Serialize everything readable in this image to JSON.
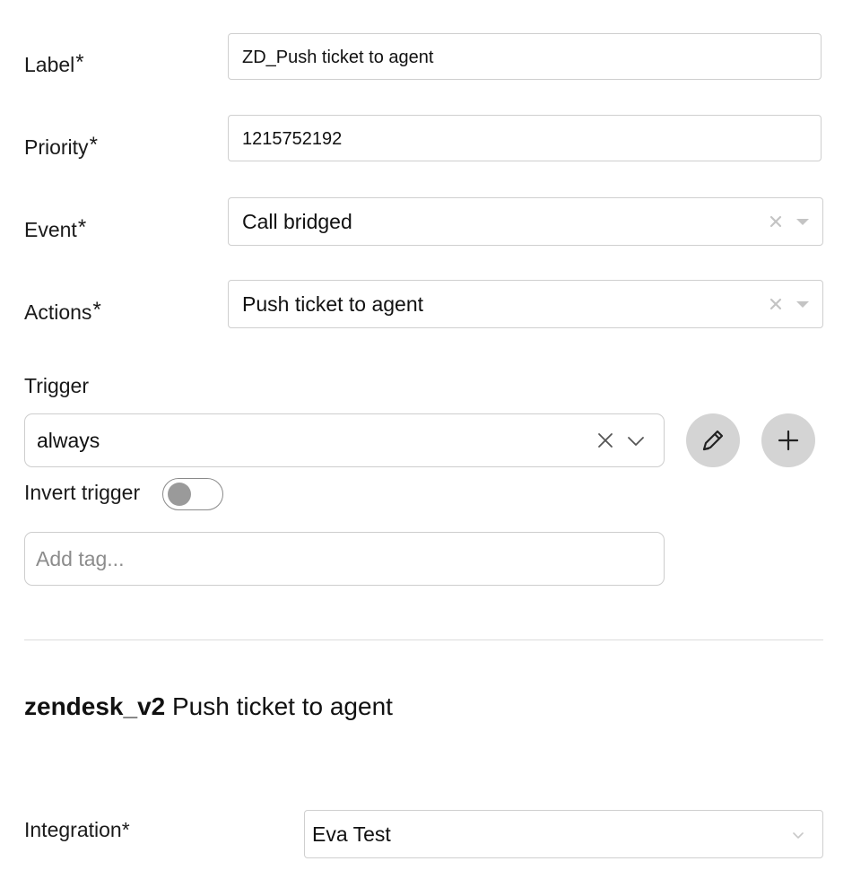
{
  "form": {
    "label": {
      "text": "Label",
      "required_mark": "*",
      "value": "ZD_Push ticket to agent"
    },
    "priority": {
      "text": "Priority",
      "required_mark": "*",
      "value": "1215752192"
    },
    "event": {
      "text": "Event",
      "required_mark": "*",
      "value": "Call bridged"
    },
    "actions": {
      "text": "Actions",
      "required_mark": "*",
      "value": "Push ticket to agent"
    },
    "trigger": {
      "text": "Trigger",
      "value": "always",
      "clear_icon": "close-icon",
      "dropdown_icon": "chevron-down-icon",
      "edit_icon": "pencil-icon",
      "add_icon": "plus-icon"
    },
    "invert_trigger": {
      "text": "Invert trigger",
      "enabled": false
    },
    "tags": {
      "placeholder": "Add tag..."
    }
  },
  "section": {
    "integration_name": "zendesk_v2",
    "action_name": "Push ticket to agent"
  },
  "integration": {
    "text": "Integration*",
    "value": "Eva Test"
  },
  "colors": {
    "border": "#cfcfcf",
    "button_bg": "#d4d4d4",
    "toggle_knob": "#9a9a9a",
    "placeholder": "#8c8c8c"
  }
}
